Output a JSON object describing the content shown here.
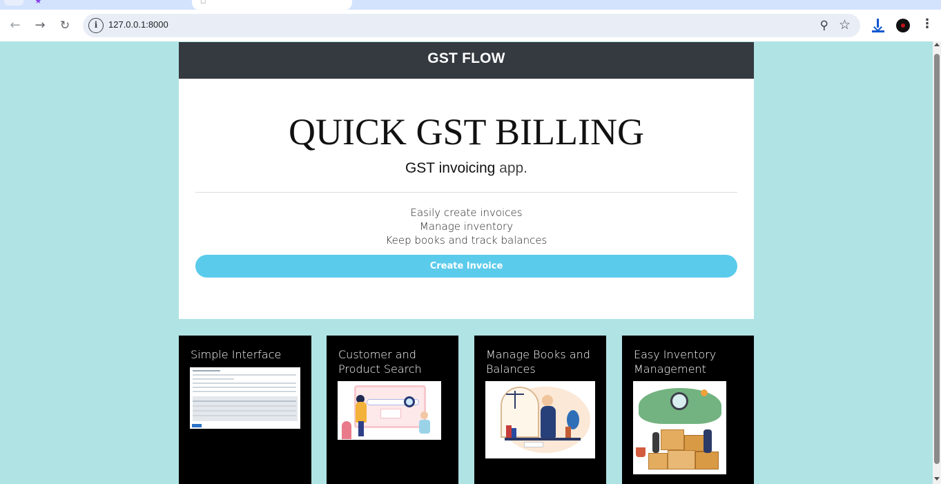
{
  "browser": {
    "url": "127.0.0.1:8000"
  },
  "navbar": {
    "brand": "GST FLOW"
  },
  "hero": {
    "title": "QUICK GST BILLING",
    "subtitle_bold": "GST invoicing",
    "subtitle_light": " app.",
    "features": [
      "Easily create invoices",
      "Manage inventory",
      "Keep books and track balances"
    ],
    "cta_label": "Create Invoice"
  },
  "cards": [
    {
      "title": "Simple Interface",
      "image": "invoice-form-screenshot"
    },
    {
      "title": "Customer and Product Search",
      "image": "search-illustration"
    },
    {
      "title": "Manage Books and Balances",
      "image": "books-balances-illustration"
    },
    {
      "title": "Easy Inventory Management",
      "image": "inventory-boxes-illustration"
    }
  ],
  "colors": {
    "page_bg": "#b0e3e4",
    "navbar_bg": "#343a40",
    "cta_bg": "#5bcbeb",
    "card_bg": "#000000"
  }
}
